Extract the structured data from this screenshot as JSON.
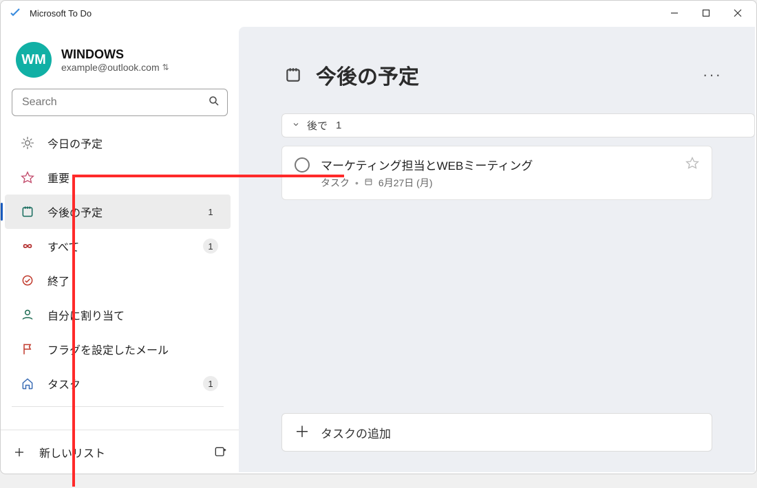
{
  "window": {
    "title": "Microsoft To Do"
  },
  "profile": {
    "initials": "WM",
    "name": "WINDOWS",
    "email": "example@outlook.com"
  },
  "search": {
    "placeholder": "Search"
  },
  "sidebar": {
    "items": [
      {
        "id": "myday",
        "label": "今日の予定",
        "icon": "sun"
      },
      {
        "id": "important",
        "label": "重要",
        "icon": "star"
      },
      {
        "id": "planned",
        "label": "今後の予定",
        "icon": "calendar",
        "count": "1",
        "active": true
      },
      {
        "id": "all",
        "label": "すべて",
        "icon": "infinity",
        "count": "1"
      },
      {
        "id": "completed",
        "label": "終了",
        "icon": "check-circle"
      },
      {
        "id": "assigned",
        "label": "自分に割り当て",
        "icon": "person"
      },
      {
        "id": "flagged",
        "label": "フラグを設定したメール",
        "icon": "flag"
      },
      {
        "id": "tasks",
        "label": "タスク",
        "icon": "home",
        "count": "1"
      }
    ],
    "new_list_label": "新しいリスト"
  },
  "main": {
    "heading": "今後の予定",
    "group": {
      "label": "後で",
      "count": "1"
    },
    "task": {
      "title": "マーケティング担当とWEBミーティング",
      "list_label": "タスク",
      "date_label": "6月27日 (月)"
    },
    "add_task_label": "タスクの追加"
  },
  "colors": {
    "avatar": "#11b0a5",
    "accent": "#185abd",
    "annotation": "#ff2a2a"
  }
}
